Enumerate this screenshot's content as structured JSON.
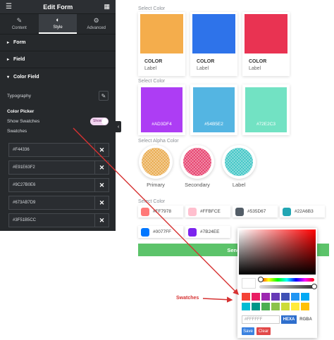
{
  "editor": {
    "title": "Edit Form",
    "tabs": [
      {
        "label": "Content",
        "icon": "pencil-icon"
      },
      {
        "label": "Style",
        "icon": "half-circle-icon"
      },
      {
        "label": "Advanced",
        "icon": "gear-icon"
      }
    ],
    "sections": [
      {
        "label": "Form"
      },
      {
        "label": "Field"
      },
      {
        "label": "Color Field"
      }
    ],
    "typography_label": "Typography",
    "color_picker_label": "Color Picker",
    "show_swatches_label": "Show Swatches",
    "toggle_label": "Show",
    "swatches_label": "Swatches",
    "swatches": [
      "#F44336",
      "#E91E63F2",
      "#9C27B0E6",
      "#673AB7D9",
      "#3F51B5CC"
    ]
  },
  "preview": {
    "group1": {
      "label": "Select Color",
      "cards": [
        {
          "color": "#F4AD4C",
          "title": "COLOR",
          "sub": "Label"
        },
        {
          "color": "#2E73EA",
          "title": "COLOR",
          "sub": "Label"
        },
        {
          "color": "#E93352",
          "title": "COLOR",
          "sub": "Label"
        }
      ]
    },
    "group2": {
      "label": "Select Color",
      "cards": [
        {
          "color": "#AD3DF4",
          "text": "#AD3DF4"
        },
        {
          "color": "#54B5E2",
          "text": "#54B5E2"
        },
        {
          "color": "#72E2C3",
          "text": "#72E2C3"
        }
      ]
    },
    "group3": {
      "label": "Select Alpha Color",
      "circles": [
        {
          "color": "#E9A94A",
          "label": "Primary"
        },
        {
          "color": "#E63C6A",
          "label": "Secondary"
        },
        {
          "color": "#3BC4C4",
          "label": "Label"
        }
      ]
    },
    "group4": {
      "label": "Select Color",
      "pills": [
        {
          "color": "#FF7978",
          "text": "#FF7978"
        },
        {
          "color": "#FFBFCE",
          "text": "#FFBFCE"
        },
        {
          "color": "#535D67",
          "text": "#535D67"
        },
        {
          "color": "#22A6B3",
          "text": "#22A6B3"
        },
        {
          "color": "#0077FF",
          "text": "#0077FF"
        },
        {
          "color": "#7B24EE",
          "text": "#7B24EE"
        }
      ]
    },
    "send_label": "Send"
  },
  "picker": {
    "hex_placeholder": "#FFFFFF",
    "mode_hexa": "HEXA",
    "mode_rgba": "RGBA",
    "save_label": "Save",
    "clear_label": "Clear",
    "swatches_row1": [
      "#F44336",
      "#E91E63",
      "#9C27B0",
      "#673AB7",
      "#3F51B5",
      "#2196F3",
      "#03A9F4"
    ],
    "swatches_row2": [
      "#00BCD4",
      "#009688",
      "#4CAF50",
      "#8BC34A",
      "#CDDC39",
      "#FFEB3B",
      "#FFC107"
    ],
    "hue_position": 0.03,
    "alpha_position": 1.0
  },
  "annotation": "Swatches"
}
